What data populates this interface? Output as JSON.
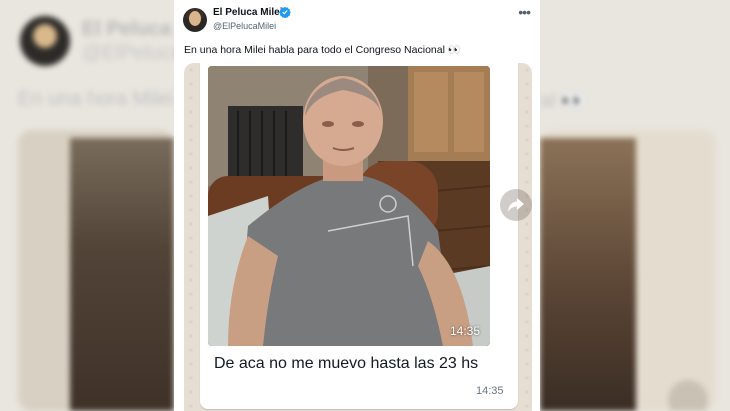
{
  "tweet": {
    "author_name": "El Peluca Milei",
    "author_handle": "@ElPelucaMilei",
    "text": "En una hora Milei habla para todo el Congreso Nacional 👀",
    "more_icon": "more-horizontal-icon",
    "verified_icon": "verified-badge-icon"
  },
  "media": {
    "photo_time": "14:35",
    "caption": "De aca no me muevo hasta las 23 hs",
    "caption_time": "14:35",
    "forward_icon": "forward-share-icon"
  },
  "background": {
    "name": "El Peluca M",
    "handle": "@ElPeluca",
    "text_left": "En una hora Milei",
    "text_right": "al 👀"
  },
  "colors": {
    "verified": "#1d9bf0",
    "text": "#0f1419",
    "secondary": "#536471",
    "chat_bg": "#e6ded2"
  }
}
